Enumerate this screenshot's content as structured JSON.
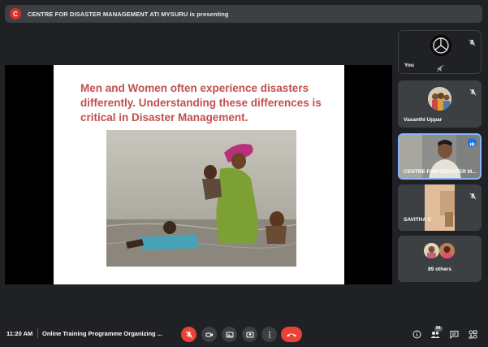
{
  "banner": {
    "avatar_letter": "C",
    "text": "CENTRE FOR DISASTER MANAGEMENT ATI MYSURU is presenting"
  },
  "slide": {
    "title": "Men and Women often experience disasters differently. Understanding these differences is critical in Disaster Management."
  },
  "participants": {
    "you": {
      "name": "You"
    },
    "vasanthi": {
      "name": "Vasanthi Uppar"
    },
    "centre": {
      "name": "CENTRE FOR DISASTER M..."
    },
    "savitha": {
      "name": "SAVITHA C"
    },
    "others": {
      "label": "89 others"
    }
  },
  "bottombar": {
    "time": "11:20 AM",
    "meeting_title": "Online Training Programme Organizing ...",
    "people_count": "94"
  },
  "colors": {
    "accent_blue": "#8ab4f8",
    "end_red": "#ea4335",
    "slide_title": "#c0504d",
    "panel": "#3c4043",
    "background": "#202124"
  }
}
